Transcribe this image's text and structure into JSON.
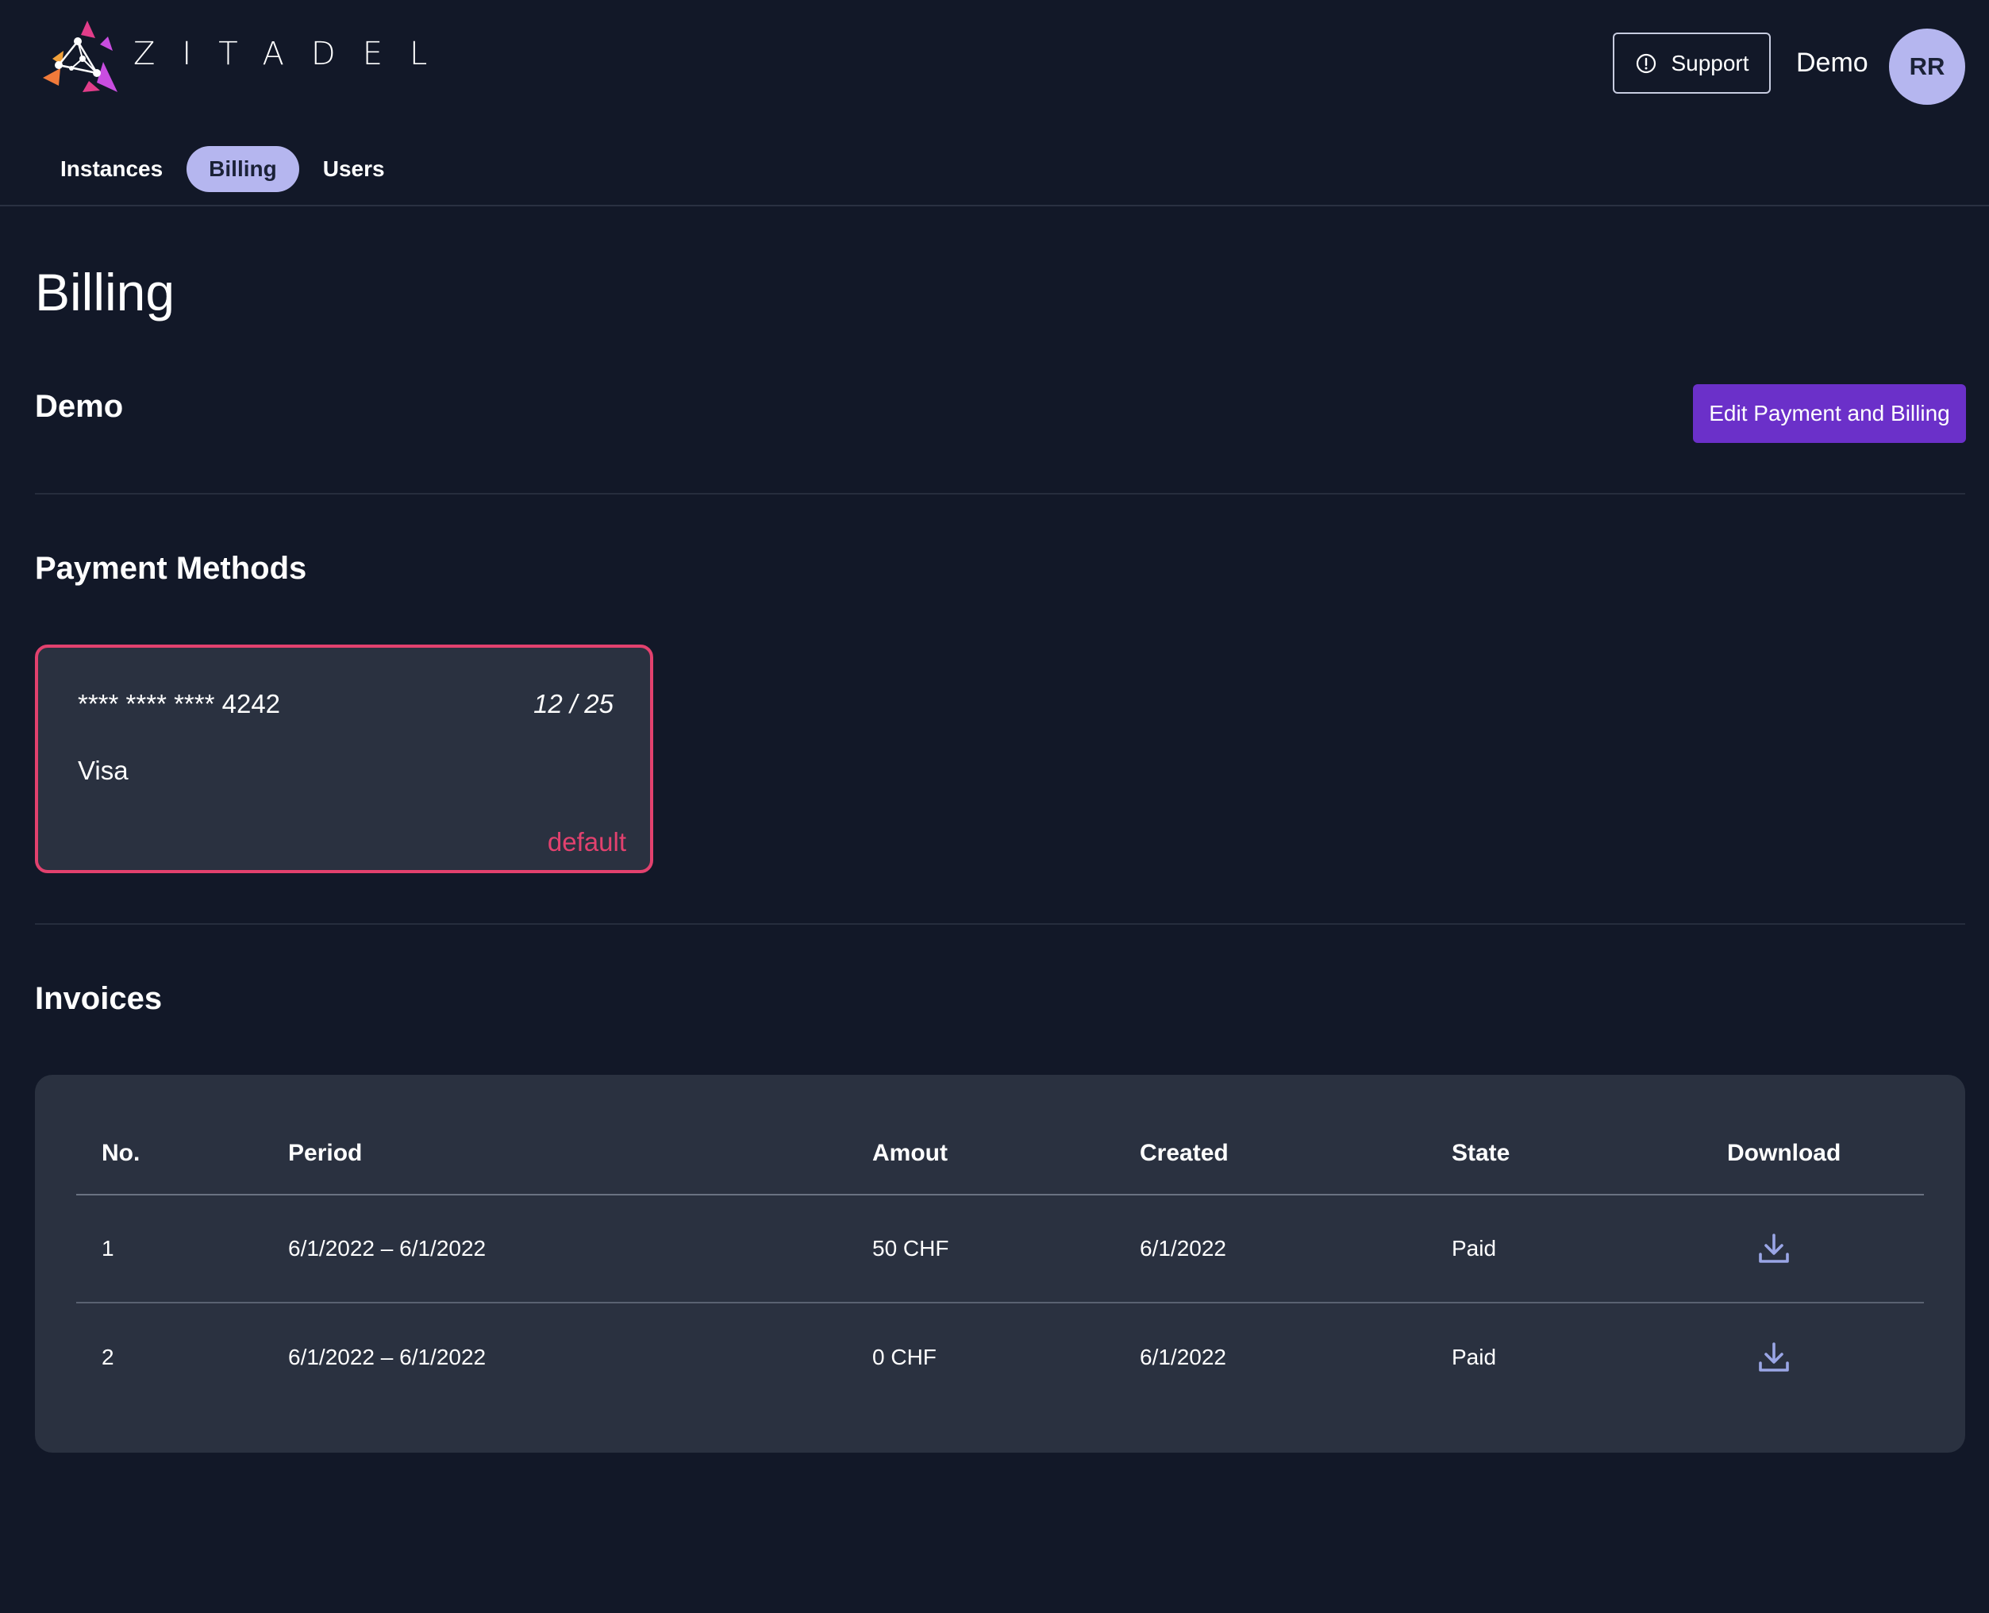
{
  "header": {
    "brand": "ZITADEL",
    "support_label": "Support",
    "org_name": "Demo",
    "avatar_initials": "RR",
    "tabs": [
      {
        "label": "Instances",
        "active": false
      },
      {
        "label": "Billing",
        "active": true
      },
      {
        "label": "Users",
        "active": false
      }
    ]
  },
  "page": {
    "title": "Billing",
    "org_section_title": "Demo",
    "edit_button_label": "Edit Payment and Billing"
  },
  "payment_methods": {
    "title": "Payment Methods",
    "cards": [
      {
        "number": "**** **** **** 4242",
        "expiry": "12 / 25",
        "brand": "Visa",
        "badge": "default"
      }
    ]
  },
  "invoices": {
    "title": "Invoices",
    "columns": [
      "No.",
      "Period",
      "Amout",
      "Created",
      "State",
      "Download"
    ],
    "rows": [
      {
        "no": "1",
        "period": "6/1/2022 – 6/1/2022",
        "amount": "50 CHF",
        "created": "6/1/2022",
        "state": "Paid",
        "download_icon": "download-icon"
      },
      {
        "no": "2",
        "period": "6/1/2022 – 6/1/2022",
        "amount": "0 CHF",
        "created": "6/1/2022",
        "state": "Paid",
        "download_icon": "download-icon"
      }
    ]
  },
  "colors": {
    "background": "#121828",
    "surface": "#2a3140",
    "accent_primary": "#6b30c9",
    "accent_tab": "#b5b6ef",
    "default_badge": "#e2416e",
    "icon_blue": "#9aa6e6"
  }
}
